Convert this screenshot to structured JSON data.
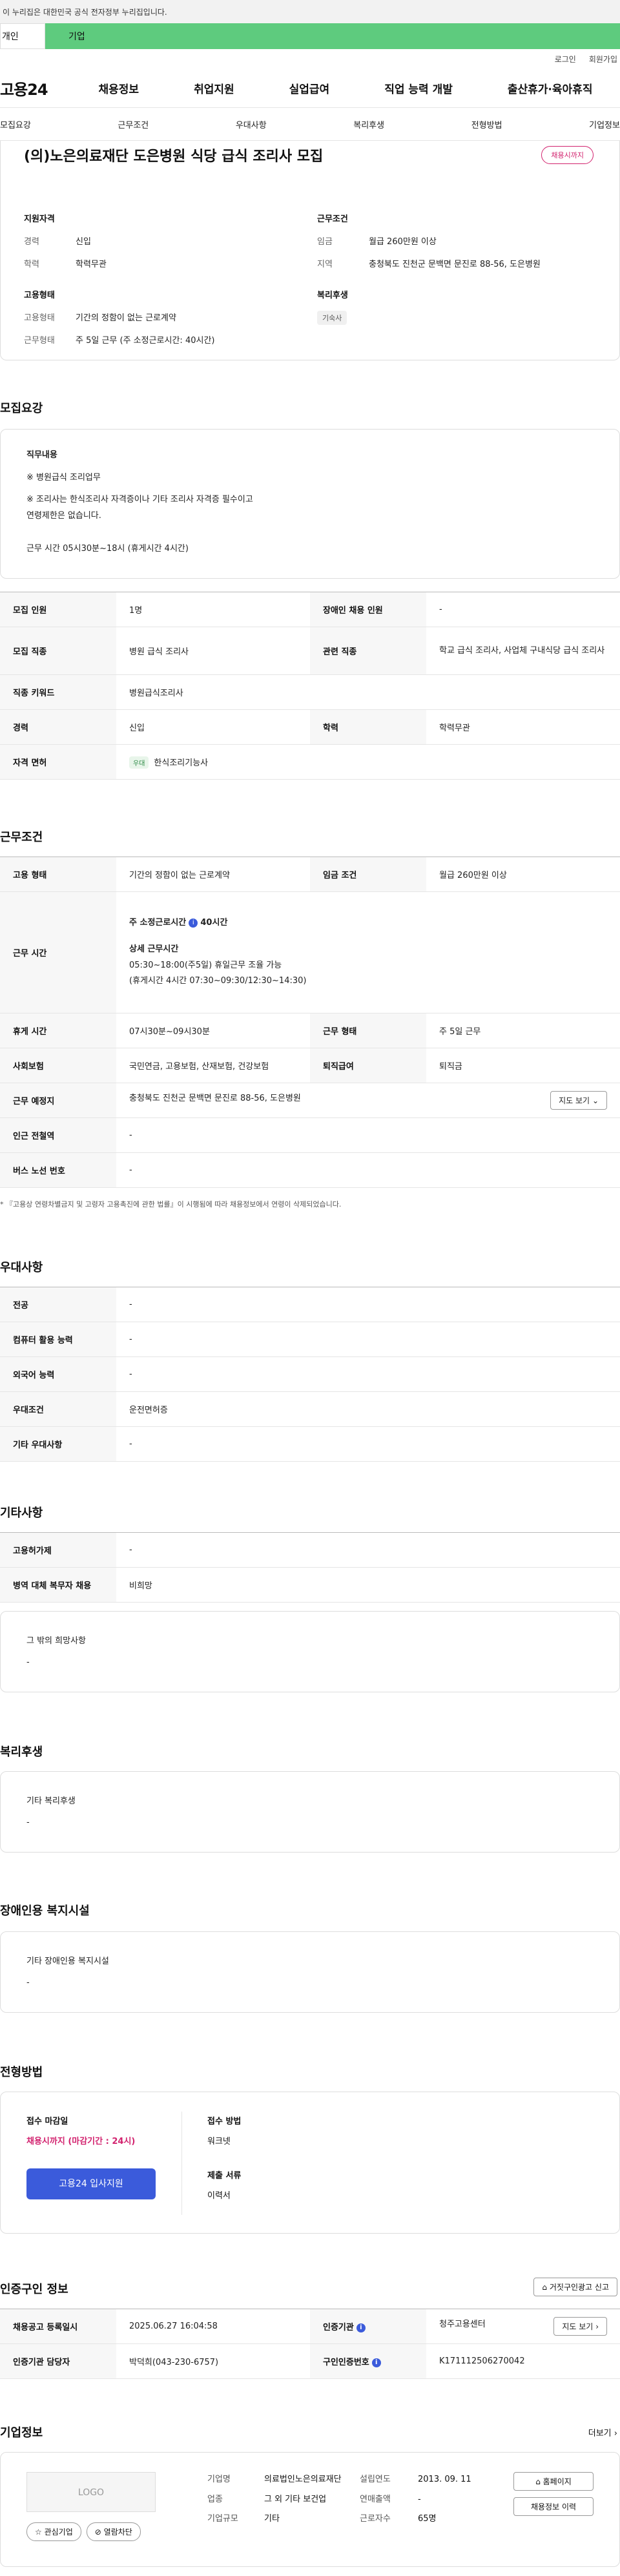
{
  "gov_banner": "이 누리집은 대한민국 공식 전자정부 누리집입니다.",
  "tabs": {
    "individual": "개인",
    "corporate": "기업"
  },
  "util": {
    "login": "로그인",
    "join": "회원가입"
  },
  "logo": "고용24",
  "gnb": [
    "채용정보",
    "취업지원",
    "실업급여",
    "직업 능력 개발",
    "출산휴가·육아휴직"
  ],
  "subnav": [
    "모집요강",
    "근무조건",
    "우대사항",
    "복리후생",
    "전형방법",
    "기업정보"
  ],
  "job": {
    "title": "(의)노은의료재단 도은병원 식당 급식 조리사 모집",
    "deadline_badge": "채용시까지",
    "qual_heading": "지원자격",
    "qual": [
      {
        "k": "경력",
        "v": "신입"
      },
      {
        "k": "학력",
        "v": "학력무관"
      }
    ],
    "cond_heading": "근무조건",
    "cond": [
      {
        "k": "임금",
        "v": "월급 260만원 이상"
      },
      {
        "k": "지역",
        "v": "충청북도 진천군 문백면 문진로 88-56, 도은병원"
      }
    ],
    "emp_heading": "고용형태",
    "emp": [
      {
        "k": "고용형태",
        "v": "기간의 정함이 없는 근로계약"
      },
      {
        "k": "근무형태",
        "v": "주 5일 근무 (주 소정근로시간: 40시간)"
      }
    ],
    "welfare_heading": "복리후생",
    "welfare_chip": "기숙사"
  },
  "recruit": {
    "heading": "모집요강",
    "duty_label": "직무내용",
    "duty_lines": [
      "※ 병원급식 조리업무",
      "※ 조리사는 한식조리사 자격증이나 기타 조리사 자격증 필수이고",
      "연령제한은 없습니다.",
      "근무 시간 05시30분~18시 (휴게시간 4시간)"
    ],
    "rows": [
      [
        "모집 인원",
        "1명",
        "장애인 채용 인원",
        "-"
      ],
      [
        "모집 직종",
        "병원 급식 조리사",
        "관련 직종",
        "학교 급식 조리사, 사업체 구내식당 급식 조리사"
      ],
      [
        "직종 키워드",
        "병원급식조리사"
      ],
      [
        "경력",
        "신입",
        "학력",
        "학력무관"
      ],
      [
        "자격 면허",
        "한식조리기능사"
      ]
    ],
    "license_tag": "우대"
  },
  "work": {
    "heading": "근무조건",
    "emp_type_label": "고용 형태",
    "emp_type": "기간의 정함이 없는 근로계약",
    "wage_label": "임금 조건",
    "wage": "월급 260만원 이상",
    "hours_label": "근무 시간",
    "hours_weekly": "주 소정근로시간",
    "hours_weekly_val": "40시간",
    "hours_detail_title": "상세 근무시간",
    "hours_detail_1": "05:30~18:00(주5일) 휴일근무 조율 가능",
    "hours_detail_2": "(휴게시간 4시간 07:30~09:30/12:30~14:30)",
    "break_label": "휴게 시간",
    "break": "07시30분~09시30분",
    "shift_label": "근무 형태",
    "shift": "주 5일 근무",
    "insurance_label": "사회보험",
    "insurance": "국민연금, 고용보험, 산재보험, 건강보험",
    "severance_label": "퇴직급여",
    "severance": "퇴직금",
    "place_label": "근무 예정지",
    "place": "충청북도 진천군 문백면 문진로 88-56, 도은병원",
    "map_btn": "지도 보기",
    "subway_label": "인근 전철역",
    "subway": "-",
    "bus_label": "버스 노선 번호",
    "bus": "-",
    "note": "* 『고용상 연령차별금지 및 고령자 고용촉진에 관한 법률』이 시행됨에 따라 채용정보에서 연령이 삭제되었습니다."
  },
  "pref": {
    "heading": "우대사항",
    "rows": [
      [
        "전공",
        "-"
      ],
      [
        "컴퓨터 활용 능력",
        "-"
      ],
      [
        "외국어 능력",
        "-"
      ],
      [
        "우대조건",
        "운전면허증"
      ],
      [
        "기타 우대사항",
        "-"
      ]
    ]
  },
  "etc": {
    "heading": "기타사항",
    "rows": [
      [
        "고용허가제",
        "-"
      ],
      [
        "병역 대체 복무자 채용",
        "비희망"
      ]
    ],
    "other_label": "그 밖의 희망사항",
    "other_val": "-"
  },
  "welfare": {
    "heading": "복리후생",
    "label": "기타 복리후생",
    "val": "-"
  },
  "disability": {
    "heading": "장애인용 복지시설",
    "label": "기타 장애인용 복지시설",
    "val": "-"
  },
  "selection": {
    "heading": "전형방법",
    "deadline_label": "접수 마감일",
    "deadline_val": "채용시까지 (마감기간 : 24시)",
    "apply_btn": "고용24 입사지원",
    "method_label": "접수 방법",
    "method_val": "워크넷",
    "docs_label": "제출 서류",
    "docs_val": "이력서"
  },
  "cert": {
    "heading": "인증구인 정보",
    "report_btn": "거짓구인광고 신고",
    "reg_label": "채용공고 등록일시",
    "reg_val": "2025.06.27 16:04:58",
    "agency_label": "인증기관",
    "agency_val": "청주고용센터",
    "map_btn": "지도 보기",
    "manager_label": "인증기관 담당자",
    "manager_val": "박덕희(043-230-6757)",
    "cert_no_label": "구인인증번호",
    "cert_no_val": "K171112506270042"
  },
  "company": {
    "heading": "기업정보",
    "more": "더보기",
    "logo_ph": "LOGO",
    "fav_btn": "관심기업",
    "block_btn": "열람차단",
    "name_label": "기업명",
    "name_val": "의료법인노은의료재단",
    "industry_label": "업종",
    "industry_val": "그 외 기타 보건업",
    "size_label": "기업규모",
    "size_val": "기타",
    "founded_label": "설립연도",
    "founded_val": "2013. 09. 11",
    "sales_label": "연매출액",
    "sales_val": "-",
    "employees_label": "근로자수",
    "employees_val": "65명",
    "home_btn": "홈페이지",
    "history_btn": "채용정보 이력"
  }
}
